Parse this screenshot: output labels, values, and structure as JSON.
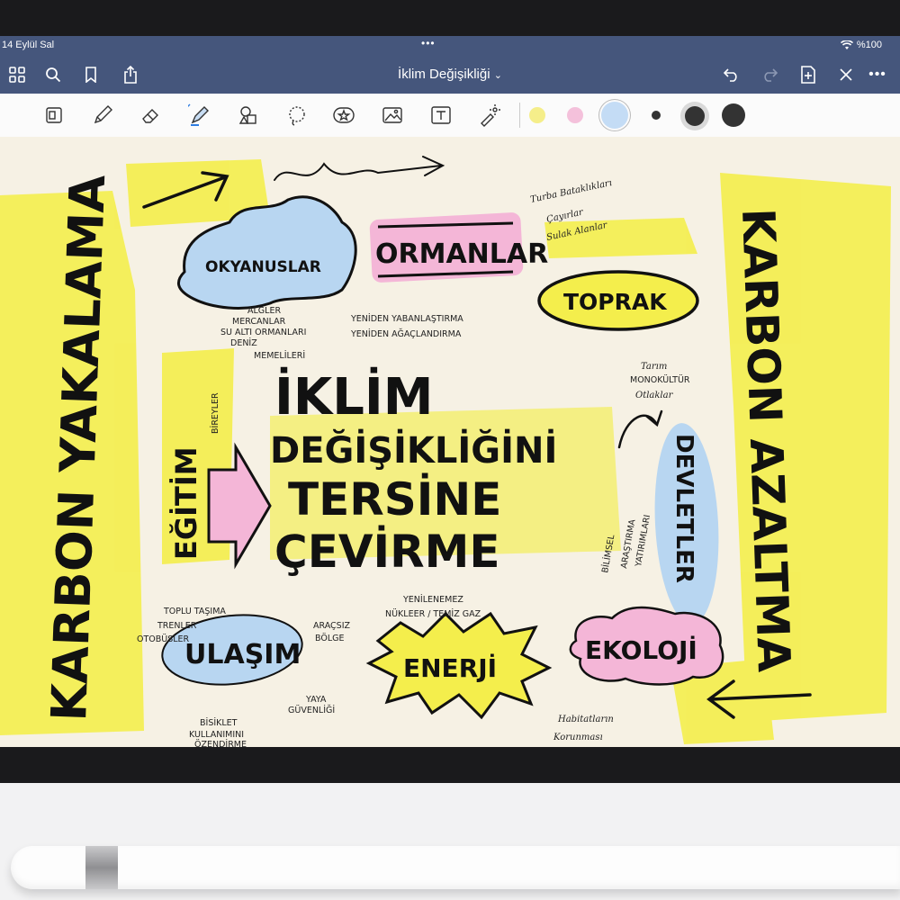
{
  "status_bar": {
    "date": "14 Eylül Sal",
    "battery": "%100"
  },
  "nav": {
    "title": "İklim Değişikliği",
    "chevron": "⌄"
  },
  "colors": {
    "nav_bg": "#45567c",
    "highlight_yellow": "#f4ee4c",
    "pink": "#f4b6d7",
    "blue": "#b8d6f1"
  },
  "toolbar": {
    "tools": [
      "page-icon",
      "pen-icon",
      "eraser-icon",
      "highlighter-icon",
      "shapes-icon",
      "lasso-icon",
      "sticker-icon",
      "image-icon",
      "text-icon",
      "laser-icon"
    ],
    "swatches": [
      "#f5ee8a",
      "#f4c1db",
      "#c4dcf5",
      "#333333",
      "#333333",
      "#333333"
    ]
  },
  "notes": {
    "left_vertical": "KARBON YAKALAMA",
    "right_vertical": "KARBON AZALTMA",
    "okyanuslar": "OKYANUSLAR",
    "okyanuslar_sub": [
      "ALGLER",
      "MERCANLAR",
      "SU ALTI ORMANLARI",
      "DENİZ",
      "MEMELİLERİ"
    ],
    "ormanlar": "ORMANLAR",
    "ormanlar_sub": [
      "YENİDEN YABANLAŞTIRMA",
      "YENİDEN AĞAÇLANDIRMA"
    ],
    "turba": [
      "Turba Bataklıkları",
      "Çayırlar",
      "Sulak Alanlar"
    ],
    "toprak": "TOPRAK",
    "tarim": [
      "Tarım",
      "MONOKÜLTÜR",
      "Otlaklar"
    ],
    "main_title": [
      "İKLİM",
      "DEĞİŞİKLİĞİNİ",
      "TERSİNE",
      "ÇEVİRME"
    ],
    "egitim": "EĞİTİM",
    "bireyler": "BİREYLER",
    "devletler": "DEVLETLER",
    "bilimsel": [
      "BİLİMSEL",
      "ARAŞTIRMA",
      "YATIRIMLARI"
    ],
    "ulasim": "ULAŞIM",
    "ulasim_sub": [
      "TOPLU TAŞIMA",
      "TRENLER",
      "OTOBÜSLER"
    ],
    "aracsiz": [
      "ARAÇSIZ",
      "BÖLGE"
    ],
    "yaya": [
      "YAYA",
      "GÜVENLİĞİ"
    ],
    "bisiklet": [
      "BİSİKLET",
      "KULLANIMINI",
      "ÖZENDİRME"
    ],
    "enerji": "ENERJİ",
    "enerji_sub": [
      "YENİLENEMEZ",
      "NÜKLEER / TEMİZ GAZ"
    ],
    "ekoloji": "EKOLOJİ",
    "habitat": [
      "Habitatların",
      "Korunması"
    ]
  },
  "pencil": {
    "brand": ""
  }
}
